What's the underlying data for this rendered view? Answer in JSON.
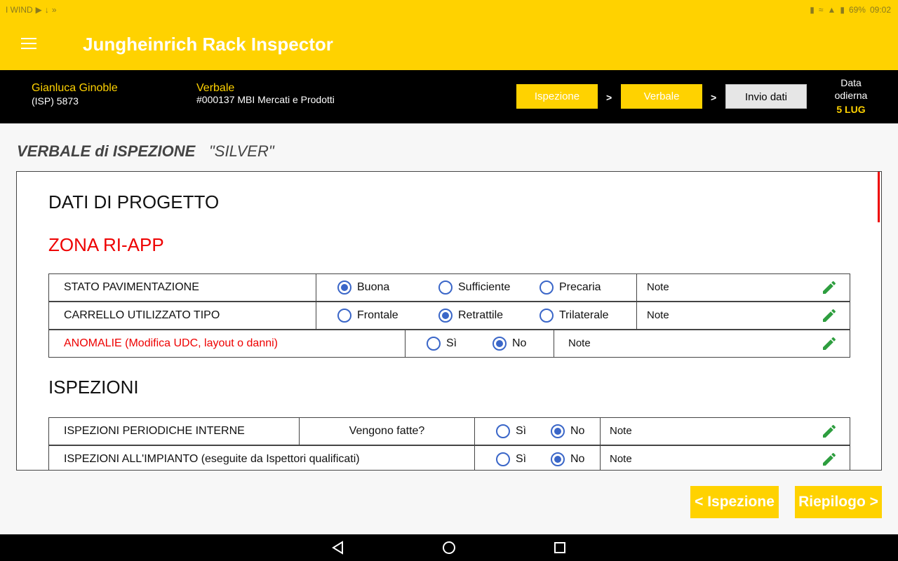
{
  "status": {
    "carrier": "I WIND",
    "battery": "69%",
    "time": "09:02"
  },
  "appbar": {
    "title": "Jungheinrich Rack Inspector"
  },
  "infobar": {
    "user_name": "Gianluca Ginoble",
    "user_id": "(ISP) 5873",
    "verbale_label": "Verbale",
    "verbale_sub": "#000137 MBI Mercati e Prodotti",
    "steps": [
      {
        "label": "Ispezione"
      },
      {
        "label": "Verbale"
      },
      {
        "label": "Invio dati"
      }
    ],
    "chevron": ">",
    "date_label": "Data odierna",
    "date_value": "5 LUG"
  },
  "heading": {
    "title": "VERBALE di ISPEZIONE",
    "subtitle": "\"SILVER\""
  },
  "sections": {
    "progetto": "DATI DI PROGETTO",
    "zona": "ZONA RI-APP",
    "ispezioni": "ISPEZIONI"
  },
  "rows": {
    "stato": {
      "label": "STATO PAVIMENTAZIONE",
      "options": [
        "Buona",
        "Sufficiente",
        "Precaria"
      ],
      "selected": "Buona",
      "note": "Note"
    },
    "carrello": {
      "label": "CARRELLO UTILIZZATO TIPO",
      "options": [
        "Frontale",
        "Retrattile",
        "Trilaterale"
      ],
      "selected": "Retrattile",
      "note": "Note"
    },
    "anomalie": {
      "label": "ANOMALIE (Modifica UDC, layout o danni)",
      "options": [
        "Sì",
        "No"
      ],
      "selected": "No",
      "note": "Note"
    },
    "periodiche": {
      "label": "ISPEZIONI PERIODICHE INTERNE",
      "question": "Vengono fatte?",
      "options": [
        "Sì",
        "No"
      ],
      "selected": "No",
      "note": "Note"
    },
    "impianto": {
      "label": "ISPEZIONI ALL'IMPIANTO (eseguite da Ispettori qualificati)",
      "options": [
        "Sì",
        "No"
      ],
      "selected": "No",
      "note": "Note"
    }
  },
  "footer": {
    "back_label": "< Ispezione",
    "next_label": "Riepilogo >"
  },
  "colors": {
    "accent": "#ffd200",
    "radio": "#3a66c8",
    "edit_icon": "#2e9e3f",
    "warning": "#e00000"
  }
}
